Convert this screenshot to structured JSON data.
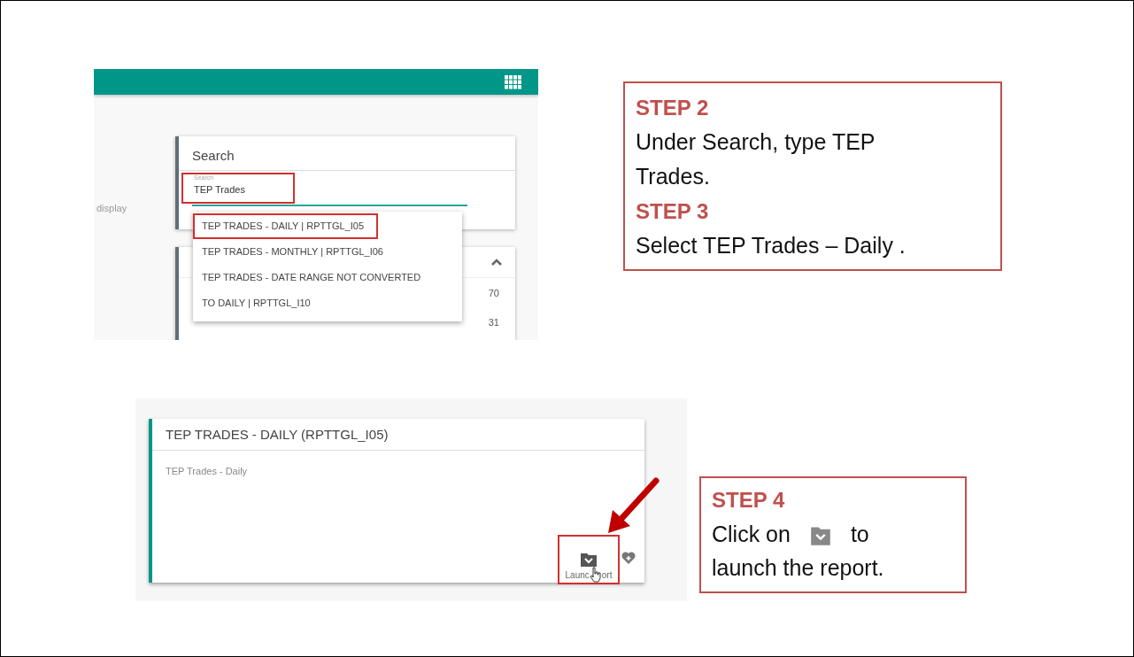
{
  "search_screenshot": {
    "side_text": "display",
    "search_card": {
      "title": "Search",
      "field": {
        "label": "Search",
        "value": "TEP Trades",
        "focused": true,
        "annotated": true
      }
    },
    "suggestions": [
      {
        "label": "TEP TRADES - DAILY | RPTTGL_I05",
        "annotated": true
      },
      {
        "label": "TEP TRADES - MONTHLY | RPTTGL_I06",
        "annotated": false
      },
      {
        "label": "TEP TRADES - DATE RANGE NOT CONVERTED",
        "annotated": false
      },
      {
        "label": "TO DAILY | RPTTGL_I10",
        "annotated": false
      }
    ],
    "category_card": {
      "rows": [
        {
          "count": "70"
        },
        {
          "count": "31"
        }
      ]
    }
  },
  "report_screenshot": {
    "card": {
      "title": "TEP TRADES - DAILY (RPTTGL_I05)",
      "description": "TEP Trades - Daily",
      "actions": [
        {
          "kind": "launch",
          "annotated": true,
          "hovered": true
        },
        {
          "kind": "favorite",
          "annotated": false
        }
      ],
      "tooltip_parts": [
        "Launc",
        "ort"
      ]
    }
  },
  "callouts": [
    {
      "steps": [
        {
          "kind": "text",
          "label": "STEP 2",
          "text": "Under Search, type TEP Trades."
        },
        {
          "kind": "text",
          "label": "STEP 3",
          "text": "Select TEP Trades – Daily ."
        }
      ]
    },
    {
      "steps": [
        {
          "kind": "icon",
          "label": "STEP 4",
          "text_before": "Click on",
          "text_after": "to",
          "text_next_line": "launch the report."
        }
      ]
    }
  ]
}
